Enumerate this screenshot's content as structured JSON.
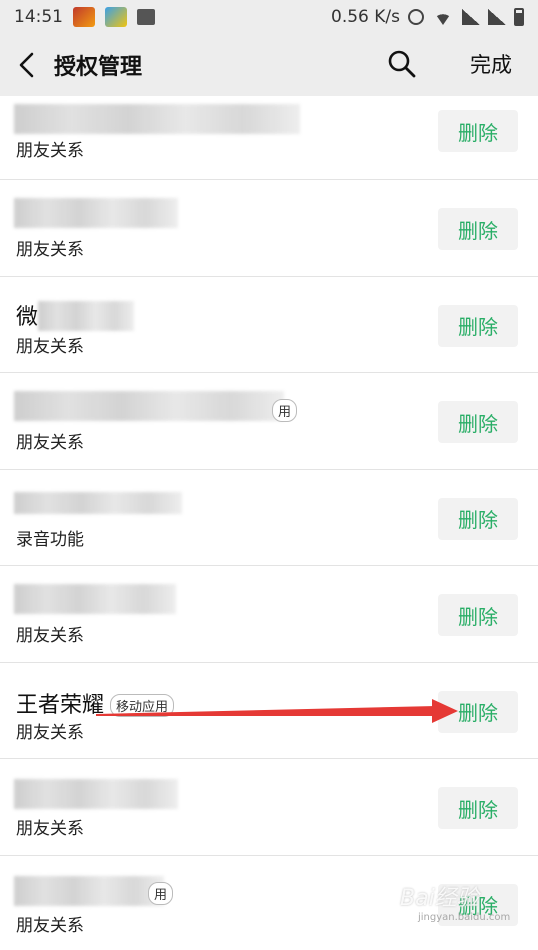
{
  "status_bar": {
    "time": "14:51",
    "speed": "0.56 K/s"
  },
  "nav": {
    "title": "授权管理",
    "done_label": "完成"
  },
  "rows": [
    {
      "permission": "朋友关系",
      "delete_label": "删除"
    },
    {
      "permission": "朋友关系",
      "delete_label": "删除"
    },
    {
      "name_partial": "微",
      "permission": "朋友关系",
      "delete_label": "删除"
    },
    {
      "tag_partial": "用",
      "permission": "朋友关系",
      "delete_label": "删除"
    },
    {
      "permission": "录音功能",
      "delete_label": "删除"
    },
    {
      "permission": "朋友关系",
      "delete_label": "删除"
    },
    {
      "name": "王者荣耀",
      "tag": "移动应用",
      "permission": "朋友关系",
      "delete_label": "删除"
    },
    {
      "permission": "朋友关系",
      "delete_label": "删除"
    },
    {
      "tag_partial": "用",
      "permission": "朋友关系",
      "delete_label": "删除"
    }
  ],
  "annotation": {
    "arrow_color": "#e53935"
  },
  "watermark": {
    "text": "Bai经验",
    "sub": "jingyan.baidu.com"
  },
  "colors": {
    "accent": "#2aae67",
    "background": "#ededed"
  }
}
